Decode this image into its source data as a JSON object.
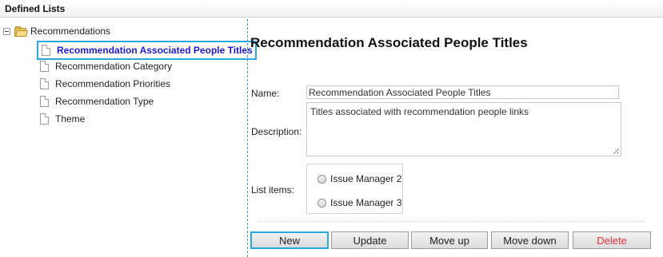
{
  "header": {
    "title": "Defined Lists"
  },
  "tree": {
    "root_label": "Recommendations",
    "items": [
      {
        "label": "Recommendation Associated People Titles",
        "selected": true
      },
      {
        "label": "Recommendation Category",
        "selected": false
      },
      {
        "label": "Recommendation Priorities",
        "selected": false
      },
      {
        "label": "Recommendation Type",
        "selected": false
      },
      {
        "label": "Theme",
        "selected": false
      }
    ]
  },
  "detail": {
    "heading": "Recommendation Associated People Titles",
    "name_label": "Name:",
    "name_value": "Recommendation Associated People Titles",
    "description_label": "Description:",
    "description_value": "Titles associated with recommendation people links",
    "list_items_label": "List items:",
    "list_items": [
      "Issue Manager 2",
      "Issue Manager 3"
    ]
  },
  "buttons": {
    "new": "New",
    "update": "Update",
    "move_up": "Move up",
    "move_down": "Move down",
    "delete": "Delete"
  },
  "colors": {
    "selection_border": "#29a7df",
    "selected_text": "#1a1ad6",
    "delete_text": "#e0323a",
    "divider": "#3a9bd9"
  }
}
